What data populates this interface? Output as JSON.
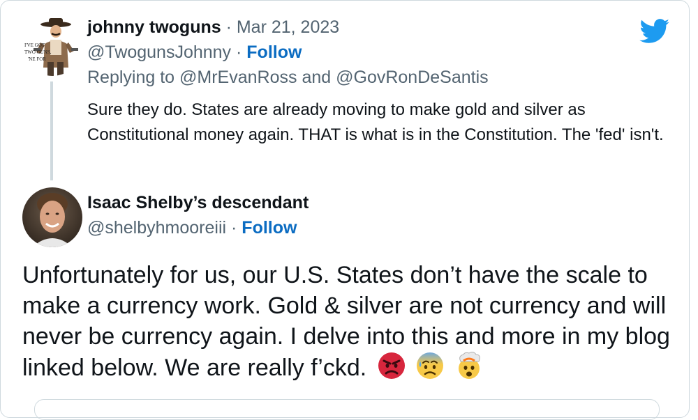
{
  "brand_color": "#1d9bf0",
  "link_color": "#0b6cc2",
  "reply": {
    "display_name": "johnny twoguns",
    "date": "Mar 21, 2023",
    "handle": "@TwogunsJohnny",
    "follow_label": "Follow",
    "replying_prefix": "Replying to ",
    "replying_user_1": "@MrEvanRoss",
    "replying_and": " and ",
    "replying_user_2": "@GovRonDeSantis",
    "text": "Sure they do.  States are already moving to make gold and silver as Constitutional money again.  THAT is what is in the Constitution.  The 'fed' isn't.",
    "avatar_caption": [
      "I'VE GOT",
      "TWO GUNS,",
      "'NE FOR"
    ]
  },
  "main": {
    "display_name": "Isaac Shelby’s descendant",
    "handle": "@shelbyhmooreiii",
    "follow_label": "Follow",
    "text": "Unfortunately for us, our U.S. States don’t have the scale to make a currency work. Gold & silver are not currency and will never be currency again. I delve into this and more in my blog linked below. We are really f’ckd.",
    "emojis": [
      "angry-face-icon",
      "anxious-face-with-sweat-icon",
      "exploding-head-icon"
    ]
  }
}
